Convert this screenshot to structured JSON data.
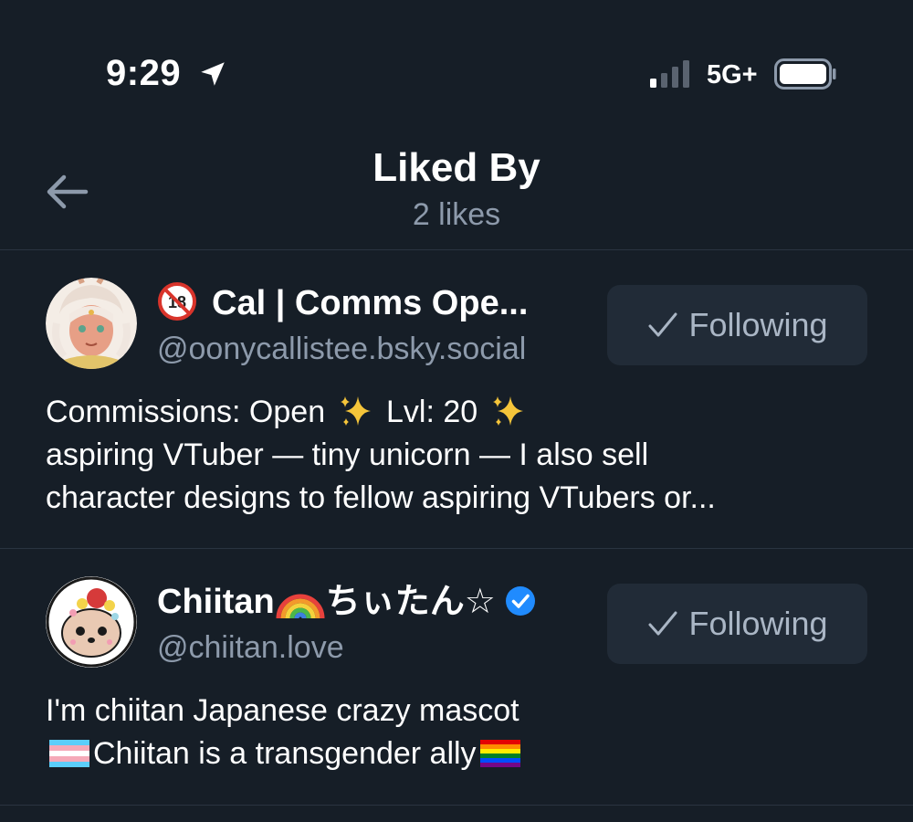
{
  "status_bar": {
    "time": "9:29",
    "network": "5G+",
    "icons": [
      "location-arrow-icon",
      "signal-icon",
      "battery-icon"
    ]
  },
  "header": {
    "title": "Liked By",
    "subtitle": "2 likes",
    "back_icon": "back-arrow-icon"
  },
  "users": [
    {
      "display_name": "Cal | Comms Ope...",
      "handle": "@oonycallistee.bsky.social",
      "follow_label": "Following",
      "bio_lines": [
        "Commissions: Open",
        "Lvl: 20",
        "aspiring VTuber — tiny unicorn — I also sell",
        "character designs to fellow aspiring VTubers or..."
      ],
      "icons": [
        "adult-18-badge-icon",
        "sparkles-icon"
      ]
    },
    {
      "display_name": "Chiitan",
      "display_name_suffix": "ちぃたん☆",
      "handle": "@chiitan.love",
      "follow_label": "Following",
      "verified": true,
      "bio_lines": [
        "I'm chiitan Japanese crazy mascot",
        "Chiitan is a transgender ally"
      ],
      "icons": [
        "rainbow-icon",
        "verified-check-icon",
        "transgender-flag-icon",
        "pride-flag-icon"
      ]
    }
  ],
  "colors": {
    "background": "#161e27",
    "divider": "#2a3440",
    "muted_text": "#8d9aab",
    "button_bg": "#212b37",
    "button_text": "#aab6c5",
    "verified_blue": "#208bfe"
  }
}
